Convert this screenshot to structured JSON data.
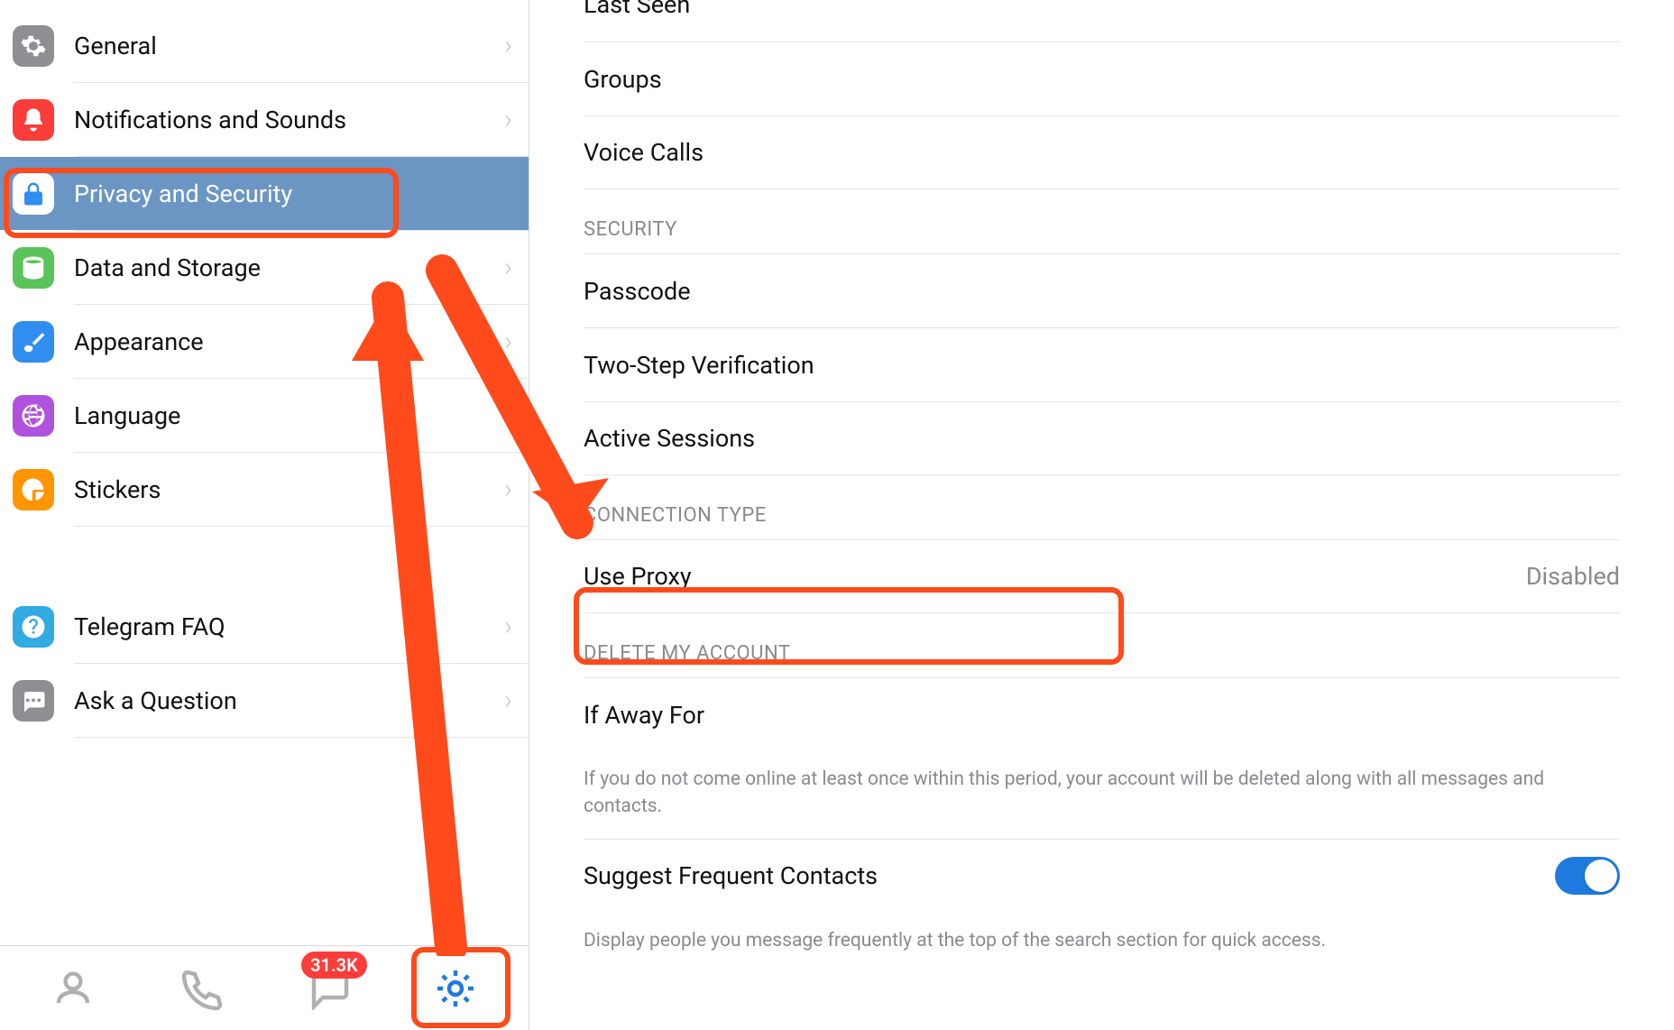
{
  "sidebar": {
    "items": [
      {
        "id": "general",
        "label": "General",
        "icon": "gear",
        "icon_class": "ic-general",
        "selected": false
      },
      {
        "id": "notif",
        "label": "Notifications and Sounds",
        "icon": "bell",
        "icon_class": "ic-notif",
        "selected": false
      },
      {
        "id": "privacy",
        "label": "Privacy and Security",
        "icon": "lock",
        "icon_class": "ic-privacy",
        "selected": true
      },
      {
        "id": "data",
        "label": "Data and Storage",
        "icon": "db",
        "icon_class": "ic-data",
        "selected": false
      },
      {
        "id": "appear",
        "label": "Appearance",
        "icon": "brush",
        "icon_class": "ic-appear",
        "selected": false
      },
      {
        "id": "lang",
        "label": "Language",
        "icon": "globe",
        "icon_class": "ic-lang",
        "selected": false
      },
      {
        "id": "stickers",
        "label": "Stickers",
        "icon": "sticker",
        "icon_class": "ic-stickers",
        "selected": false
      }
    ],
    "support_items": [
      {
        "id": "faq",
        "label": "Telegram FAQ",
        "icon": "question",
        "icon_class": "ic-faq"
      },
      {
        "id": "ask",
        "label": "Ask a Question",
        "icon": "chat",
        "icon_class": "ic-ask"
      }
    ]
  },
  "tabs": {
    "items": [
      {
        "id": "contacts",
        "icon": "person",
        "active": false
      },
      {
        "id": "calls",
        "icon": "phone",
        "active": false
      },
      {
        "id": "chats",
        "icon": "bubble",
        "active": false,
        "badge": "31.3K"
      },
      {
        "id": "settings",
        "icon": "gear-big",
        "active": true
      }
    ]
  },
  "content": {
    "privacy_rows": [
      {
        "label": "Last Seen"
      },
      {
        "label": "Groups"
      },
      {
        "label": "Voice Calls"
      }
    ],
    "security": {
      "header": "SECURITY",
      "rows": [
        {
          "label": "Passcode"
        },
        {
          "label": "Two-Step Verification"
        },
        {
          "label": "Active Sessions"
        }
      ]
    },
    "connection": {
      "header": "CONNECTION TYPE",
      "rows": [
        {
          "label": "Use Proxy",
          "value": "Disabled"
        }
      ]
    },
    "delete": {
      "header": "DELETE MY ACCOUNT",
      "rows": [
        {
          "label": "If Away For"
        }
      ],
      "footnote": "If you do not come online at least once within this period, your account will be deleted along with all messages and contacts."
    },
    "suggest": {
      "rows": [
        {
          "label": "Suggest Frequent Contacts",
          "toggle": true
        }
      ],
      "footnote": "Display people you message frequently at the top of the search section for quick access."
    }
  },
  "annotation": {
    "color": "#ff4a1c",
    "highlight_sidebar_item": "privacy",
    "highlight_content_row": "Use Proxy",
    "highlight_tab": "settings"
  }
}
